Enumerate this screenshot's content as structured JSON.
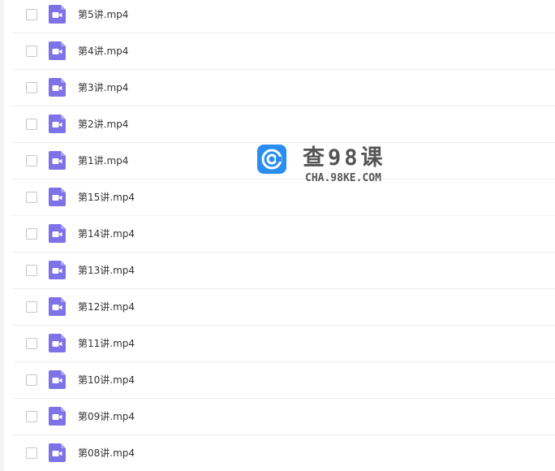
{
  "files": [
    {
      "name": "第5讲.mp4",
      "icon": "video-file-icon"
    },
    {
      "name": "第4讲.mp4",
      "icon": "video-file-icon"
    },
    {
      "name": "第3讲.mp4",
      "icon": "video-file-icon"
    },
    {
      "name": "第2讲.mp4",
      "icon": "video-file-icon"
    },
    {
      "name": "第1讲.mp4",
      "icon": "video-file-icon"
    },
    {
      "name": "第15讲.mp4",
      "icon": "video-file-icon"
    },
    {
      "name": "第14讲.mp4",
      "icon": "video-file-icon"
    },
    {
      "name": "第13讲.mp4",
      "icon": "video-file-icon"
    },
    {
      "name": "第12讲.mp4",
      "icon": "video-file-icon"
    },
    {
      "name": "第11讲.mp4",
      "icon": "video-file-icon"
    },
    {
      "name": "第10讲.mp4",
      "icon": "video-file-icon"
    },
    {
      "name": "第09讲.mp4",
      "icon": "video-file-icon"
    },
    {
      "name": "第08讲.mp4",
      "icon": "video-file-icon"
    }
  ],
  "watermark": {
    "title": "查98课",
    "url": "CHA.98KE.COM"
  },
  "colors": {
    "icon_fill": "#7d72e8",
    "text": "#333333",
    "row_border": "#efefef",
    "logo_blue": "#2a8df0"
  }
}
